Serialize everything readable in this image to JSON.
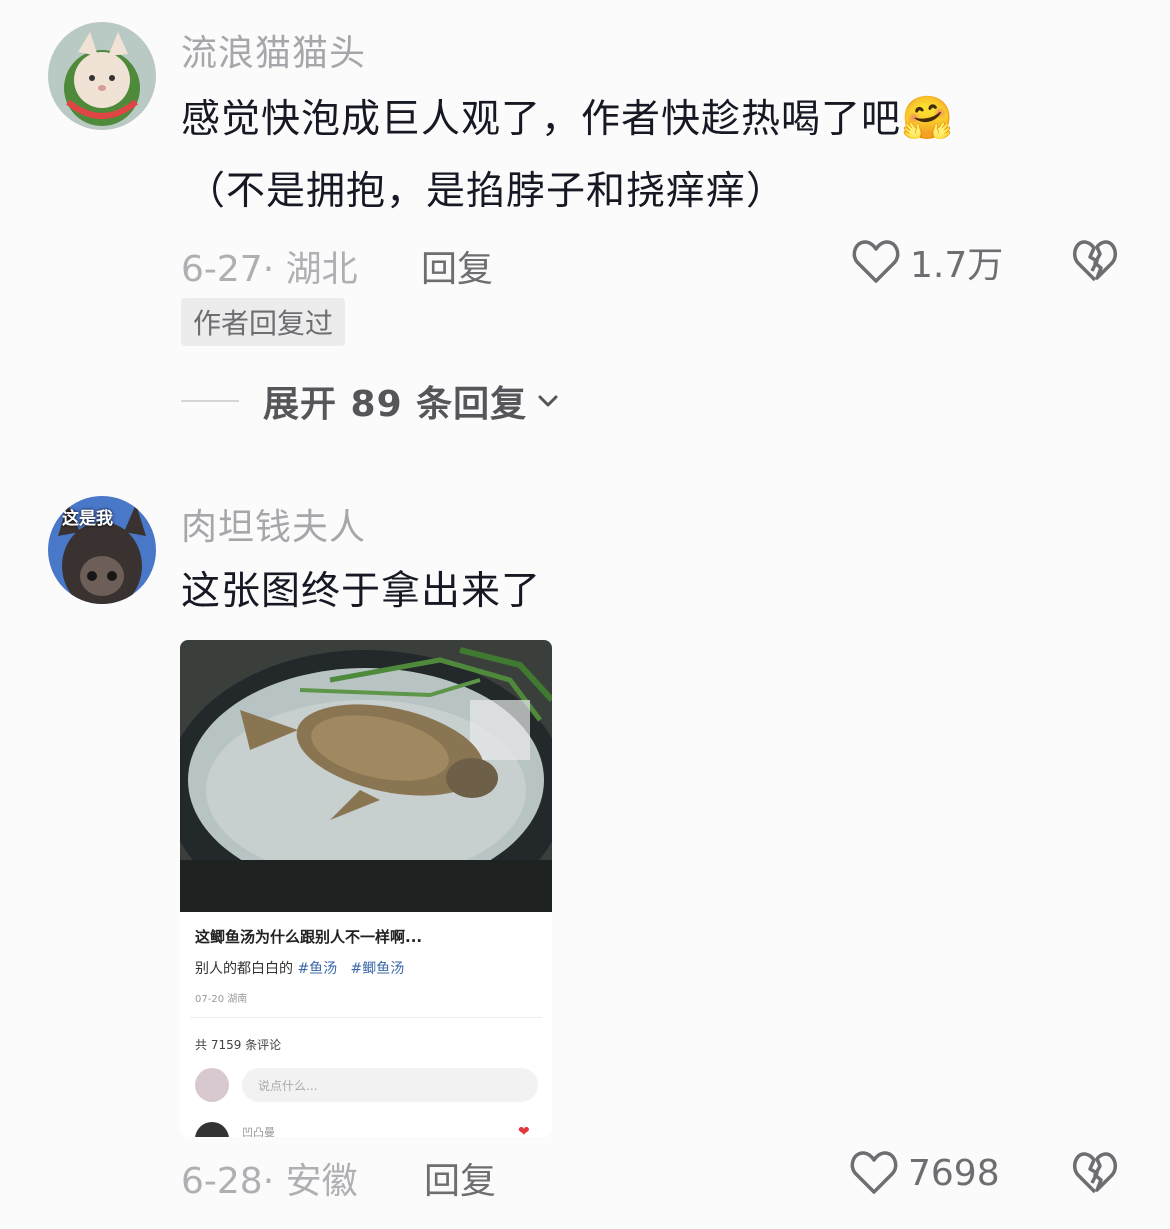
{
  "comments": [
    {
      "username": "流浪猫猫头",
      "line1": "感觉快泡成巨人观了，作者快趁热喝了吧",
      "emoji": "🤗",
      "line2": "（不是拥抱，是掐脖子和挠痒痒）",
      "date_location": "6-27· 湖北",
      "reply_label": "回复",
      "likes": "1.7万",
      "badge": "作者回复过",
      "expand_label": "展开 89 条回复"
    },
    {
      "username": "肉坦钱夫人",
      "avatar_caption": "这是我",
      "text": "这张图终于拿出来了",
      "date_location": "6-28· 安徽",
      "reply_label": "回复",
      "likes": "7698"
    }
  ],
  "embedded_screenshot": {
    "title": "这鲫鱼汤为什么跟别人不一样啊...",
    "desc_prefix": "别人的都白白的 ",
    "tag1": "#鱼汤",
    "tag2": "#鲫鱼汤",
    "date": "07-20 湖南",
    "comment_count": "共 7159 条评论",
    "input_placeholder": "说点什么...",
    "next_user": "凹凸曼"
  },
  "colors": {
    "text": "#161823",
    "muted": "#a7a7ab",
    "accent_like": "#e5363d",
    "tag": "#3a67a8"
  },
  "icons": [
    "heart-outline-icon",
    "broken-heart-icon",
    "chevron-down-icon"
  ]
}
